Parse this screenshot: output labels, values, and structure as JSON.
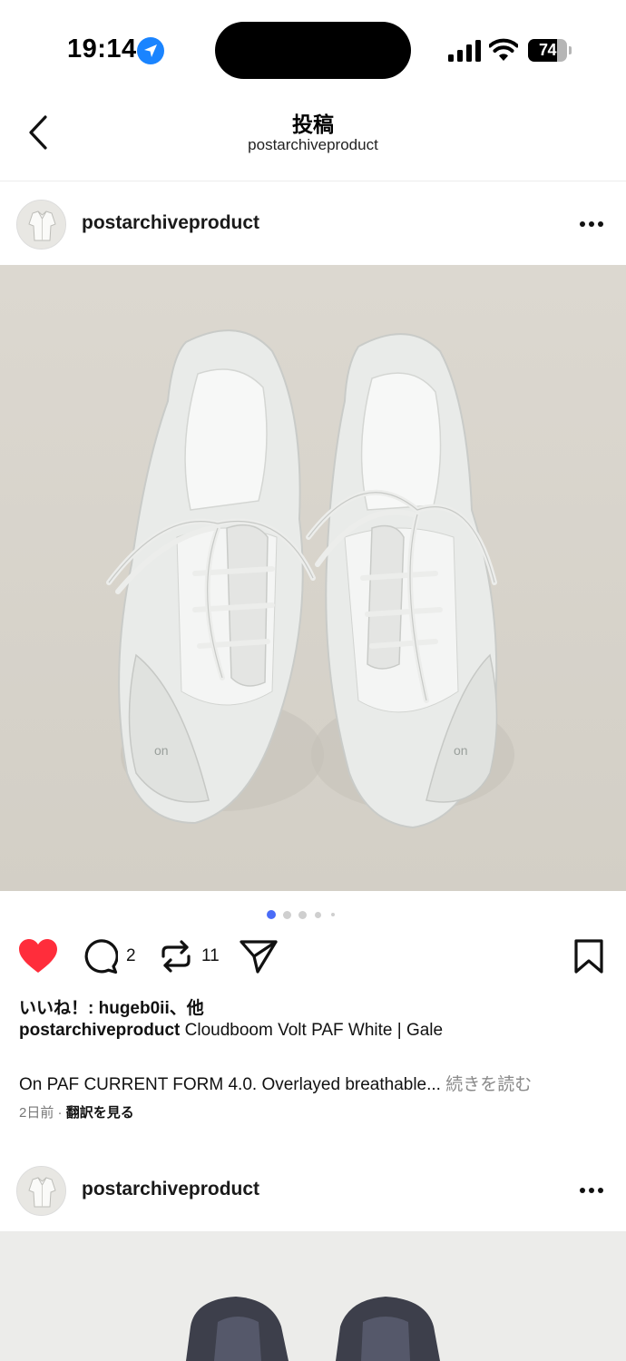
{
  "status_bar": {
    "time": "19:14",
    "battery": "74",
    "battery_level": 0.74,
    "icons": [
      "location-arrow-icon",
      "cellular-signal-icon",
      "wifi-icon",
      "battery-icon"
    ]
  },
  "header": {
    "title": "投稿",
    "subtitle": "postarchiveproduct",
    "back_icon": "chevron-left-icon"
  },
  "post": {
    "username": "postarchiveproduct",
    "more_icon": "ellipsis-icon",
    "image_subject": "pair of white sneakers",
    "carousel": {
      "count": 5,
      "active": 0,
      "active_color": "#4a6cf7"
    },
    "actions": {
      "liked": true,
      "like_color": "#ff2d3b",
      "comment_count": "2",
      "repost_count": "11",
      "icons": [
        "heart-icon",
        "comment-icon",
        "repost-icon",
        "send-icon",
        "bookmark-icon"
      ]
    },
    "likes_text": "いいね！: hugeb0ii、他",
    "caption_user": "postarchiveproduct",
    "caption_text": " Cloudboom Volt PAF White | Gale",
    "body_text": "On PAF CURRENT FORM 4.0. Overlayed breathable...",
    "more_label": " 続きを読む",
    "time_ago": "2日前",
    "separator": " · ",
    "translate_label": "翻訳を見る"
  },
  "next_post": {
    "username": "postarchiveproduct",
    "more_icon": "ellipsis-icon"
  }
}
